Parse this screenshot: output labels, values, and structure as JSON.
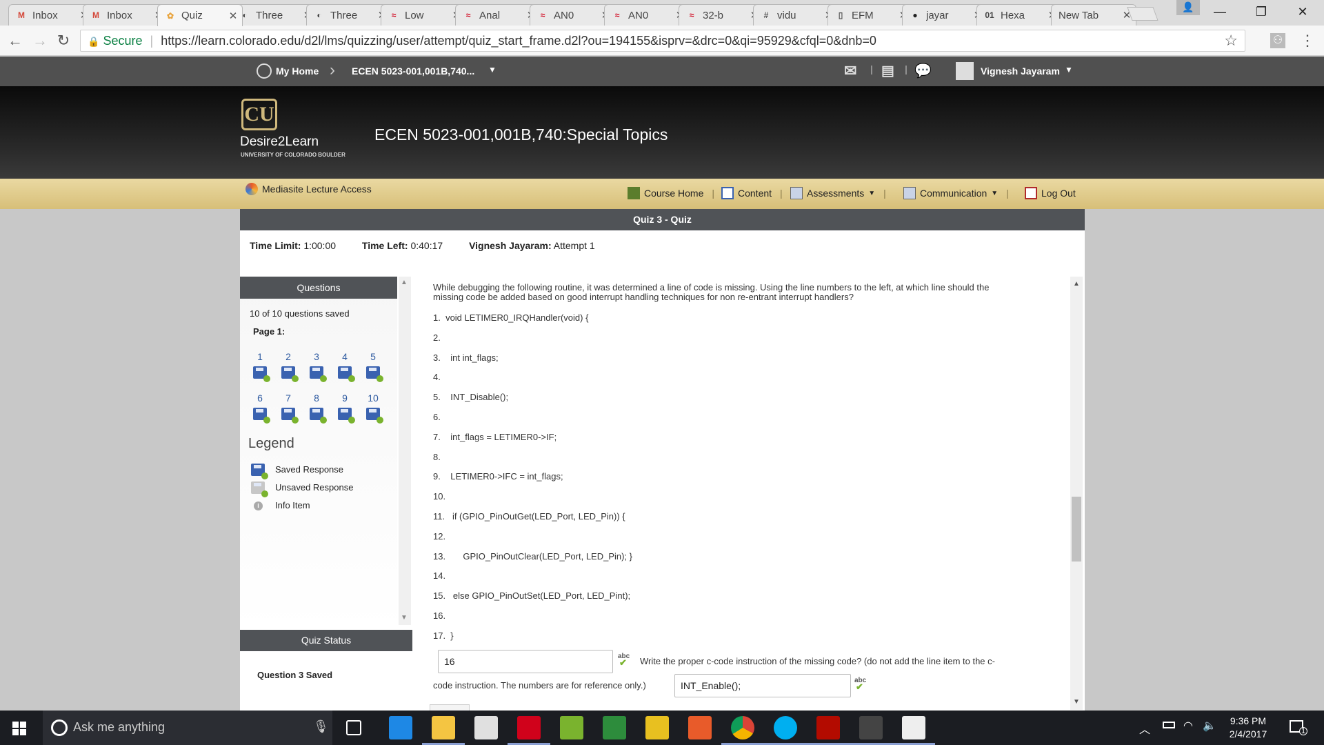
{
  "browser": {
    "tabs": [
      {
        "title": "Inbox",
        "icon": "gmail-icon",
        "glyph": "M",
        "color": "#d44638",
        "active": false
      },
      {
        "title": "Inbox",
        "icon": "gmail-icon",
        "glyph": "M",
        "color": "#d44638",
        "active": false
      },
      {
        "title": "Quiz",
        "icon": "d2l-icon",
        "glyph": "✿",
        "color": "#e8a33c",
        "active": true
      },
      {
        "title": "Three",
        "icon": "document-icon",
        "glyph": "◐",
        "color": "#444",
        "active": false
      },
      {
        "title": "Three",
        "icon": "document-icon",
        "glyph": "◐",
        "color": "#444",
        "active": false
      },
      {
        "title": "Low",
        "icon": "silabs-icon",
        "glyph": "≈",
        "color": "#d0021b",
        "active": false
      },
      {
        "title": "Anal",
        "icon": "silabs-icon",
        "glyph": "≈",
        "color": "#d0021b",
        "active": false
      },
      {
        "title": "AN0",
        "icon": "silabs-icon",
        "glyph": "≈",
        "color": "#d0021b",
        "active": false
      },
      {
        "title": "AN0",
        "icon": "silabs-icon",
        "glyph": "≈",
        "color": "#d0021b",
        "active": false
      },
      {
        "title": "32-b",
        "icon": "silabs-icon",
        "glyph": "≈",
        "color": "#d0021b",
        "active": false
      },
      {
        "title": "vidu",
        "icon": "hash-icon",
        "glyph": "#",
        "color": "#555",
        "active": false
      },
      {
        "title": "EFM",
        "icon": "page-icon",
        "glyph": "▯",
        "color": "#555",
        "active": false
      },
      {
        "title": "jayar",
        "icon": "github-icon",
        "glyph": "●",
        "color": "#222",
        "active": false
      },
      {
        "title": "Hexa",
        "icon": "hex-icon",
        "glyph": "01",
        "color": "#444",
        "active": false
      },
      {
        "title": "New Tab",
        "icon": "",
        "glyph": "",
        "color": "#444",
        "active": false
      }
    ],
    "secure_label": "Secure",
    "url": "https://learn.colorado.edu/d2l/lms/quizzing/user/attempt/quiz_start_frame.d2l?ou=194155&isprv=&drc=0&qi=95929&cfql=0&dnb=0"
  },
  "minibar": {
    "my_home": "My Home",
    "course_crumb": "ECEN 5023-001,001B,740...",
    "user_name": "Vignesh Jayaram"
  },
  "header": {
    "logo_text": "Desire2Learn",
    "logo_subtext": "UNIVERSITY OF COLORADO BOULDER",
    "course_title": "ECEN 5023-001,001B,740:Special Topics"
  },
  "navbar": {
    "mediasite": "Mediasite Lecture Access",
    "course_home": "Course Home",
    "content": "Content",
    "assessments": "Assessments",
    "communication": "Communication",
    "logout": "Log Out"
  },
  "quiz": {
    "title": "Quiz 3 - Quiz",
    "time_limit_label": "Time Limit:",
    "time_limit_value": "1:00:00",
    "time_left_label": "Time Left:",
    "time_left_value": "0:40:17",
    "attempt_user": "Vignesh Jayaram:",
    "attempt_value": "Attempt 1",
    "questions_header": "Questions",
    "saved_count": "10 of 10 questions saved",
    "page_label": "Page 1:",
    "question_numbers": [
      "1",
      "2",
      "3",
      "4",
      "5",
      "6",
      "7",
      "8",
      "9",
      "10"
    ],
    "legend_title": "Legend",
    "legend_items": [
      "Saved Response",
      "Unsaved Response",
      "Info Item"
    ],
    "status_header": "Quiz Status",
    "status_text": "Question 3 Saved",
    "question_text_1": "While debugging the following routine, it was determined a line of code is missing.  Using the line numbers to the left, at which line should the",
    "question_text_2": "missing code be added based on good interrupt handling techniques for non re-entrant interrupt handlers?",
    "code_lines": [
      "1.  void LETIMER0_IRQHandler(void) {",
      "2.",
      "3.    int int_flags;",
      "4.",
      "5.    INT_Disable();",
      "6.",
      "7.    int_flags = LETIMER0->IF;",
      "8.",
      "9.    LETIMER0->IFC = int_flags;",
      "10.",
      "11.   if (GPIO_PinOutGet(LED_Port, LED_Pin)) {",
      "12.",
      "13.       GPIO_PinOutClear(LED_Port, LED_Pin); }",
      "14.",
      "15.   else GPIO_PinOutSet(LED_Port, LED_Pint);",
      "16.",
      "17.  }"
    ],
    "answer_line": "16",
    "followup_text_1": "Write the proper c-code instruction of the missing code? (do not add the line item to the c-",
    "followup_text_2": "code instruction.  The numbers are for reference only.)",
    "answer_code": "INT_Enable();",
    "spell_label": "abc"
  },
  "taskbar": {
    "search_placeholder": "Ask me anything",
    "time": "9:36 PM",
    "date": "2/4/2017",
    "notification_count": "1"
  }
}
